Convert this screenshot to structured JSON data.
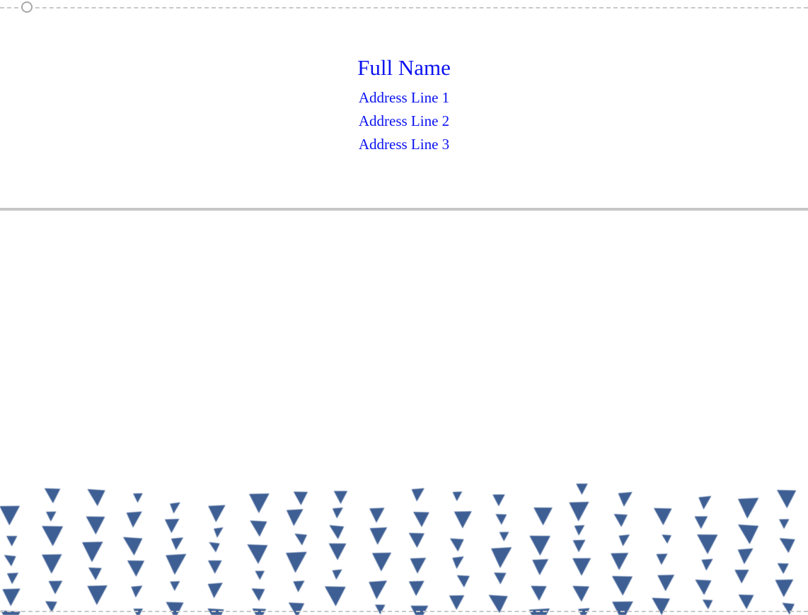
{
  "recipient": {
    "full_name": "Full Name",
    "address_line_1": "Address Line 1",
    "address_line_2": "Address Line 2",
    "address_line_3": "Address Line 3"
  },
  "colors": {
    "text": "#0a12f0",
    "pattern": "#3e5f94",
    "guides": "#c8c8c8"
  },
  "decoration": {
    "pattern_icon": "triangle-down-icon",
    "handle_icon": "rotate-handle-icon"
  }
}
